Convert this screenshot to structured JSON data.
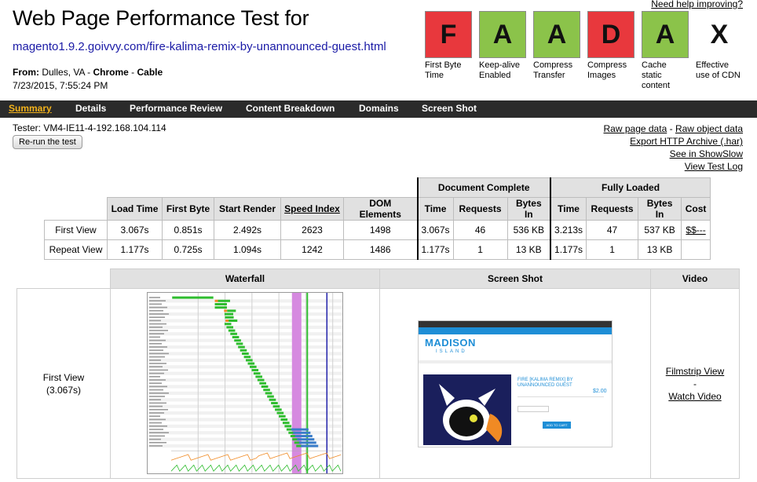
{
  "header": {
    "help_link": "Need help improving?",
    "title": "Web Page Performance Test for",
    "url": "magento1.9.2.goivvy.com/fire-kalima-remix-by-unannounced-guest.html",
    "from_label": "From:",
    "location": "Dulles, VA",
    "browser": "Chrome",
    "connection": "Cable",
    "date": "7/23/2015, 7:55:24 PM"
  },
  "grades": [
    {
      "letter": "F",
      "label": "First Byte Time",
      "color": "#e8383d"
    },
    {
      "letter": "A",
      "label": "Keep-alive Enabled",
      "color": "#8bc34a"
    },
    {
      "letter": "A",
      "label": "Compress Transfer",
      "color": "#8bc34a"
    },
    {
      "letter": "D",
      "label": "Compress Images",
      "color": "#e8383d"
    },
    {
      "letter": "A",
      "label": "Cache static content",
      "color": "#8bc34a"
    },
    {
      "letter": "X",
      "label": "Effective use of CDN",
      "color": "#ffffff"
    }
  ],
  "nav": {
    "items": [
      "Summary",
      "Details",
      "Performance Review",
      "Content Breakdown",
      "Domains",
      "Screen Shot"
    ],
    "active": "Summary"
  },
  "tester": {
    "text": "Tester: VM4-IE11-4-192.168.104.114",
    "rerun_label": "Re-run the test"
  },
  "links": {
    "raw_page": "Raw page data",
    "dash": "-",
    "raw_object": "Raw object data",
    "export_har": "Export HTTP Archive (.har)",
    "showslow": "See in ShowSlow",
    "test_log": "View Test Log"
  },
  "results": {
    "group_document": "Document Complete",
    "group_fully": "Fully Loaded",
    "headers": [
      "Load Time",
      "First Byte",
      "Start Render",
      "Speed Index",
      "DOM Elements",
      "Time",
      "Requests",
      "Bytes In",
      "Time",
      "Requests",
      "Bytes In",
      "Cost"
    ],
    "rows": [
      {
        "label": "First View",
        "values": [
          "3.067s",
          "0.851s",
          "2.492s",
          "2623",
          "1498",
          "3.067s",
          "46",
          "536 KB",
          "3.213s",
          "47",
          "537 KB",
          "$$---"
        ]
      },
      {
        "label": "Repeat View",
        "values": [
          "1.177s",
          "0.725s",
          "1.094s",
          "1242",
          "1486",
          "1.177s",
          "1",
          "13 KB",
          "1.177s",
          "1",
          "13 KB",
          ""
        ]
      }
    ]
  },
  "media": {
    "headers": [
      "Waterfall",
      "Screen Shot",
      "Video"
    ],
    "row_label": "First View",
    "row_time": "(3.067s)",
    "filmstrip_link": "Filmstrip View",
    "dash": "-",
    "watch_link": "Watch Video"
  },
  "waterfall": {
    "time_ticks": 6,
    "render_start_s": 2.492,
    "doc_complete_s": 3.067,
    "fully_loaded_s": 3.213,
    "max_s": 3.5
  },
  "screenshot": {
    "brand": "MADISON",
    "brand_sub": "ISLAND",
    "product_title": "FIRE [KALIMA REMIX] BY UNANNOUNCED GUEST",
    "price": "$2.00",
    "cart_button": "ADD TO CART"
  },
  "colors": {
    "nav_bg": "#2b2b2b",
    "nav_active": "#f3b21b",
    "url": "#1a1aa6",
    "table_header": "#e1e1e1",
    "wf_green": "#2fbd2f",
    "wf_orange": "#f08a24",
    "wf_blue": "#3a7dc9",
    "wf_purple": "#d68ae0"
  }
}
